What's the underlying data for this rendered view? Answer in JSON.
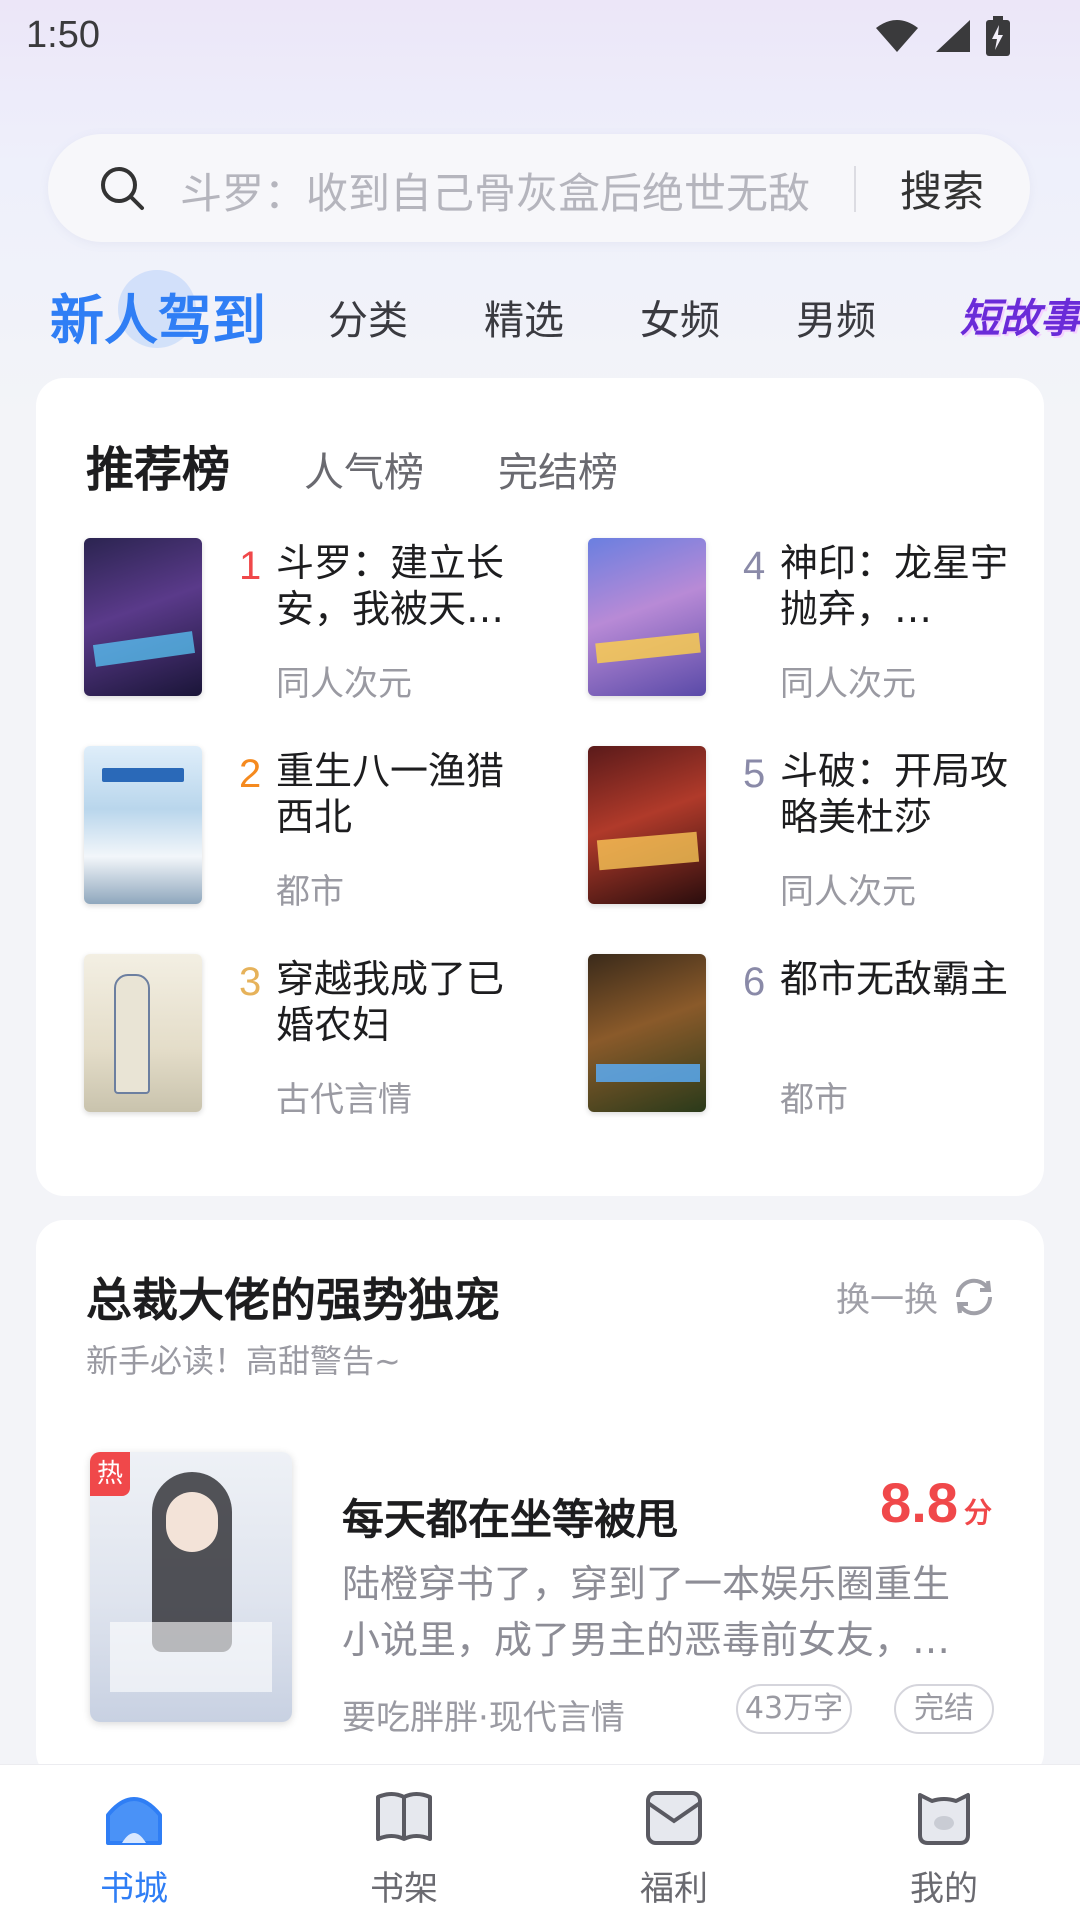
{
  "status": {
    "time": "1:50"
  },
  "search": {
    "placeholder": "斗罗：收到自己骨灰盒后绝世无敌",
    "button": "搜索"
  },
  "tabs": [
    {
      "label": "新人驾到",
      "active": true
    },
    {
      "label": "分类"
    },
    {
      "label": "精选"
    },
    {
      "label": "女频"
    },
    {
      "label": "男频"
    },
    {
      "label": "短故事"
    }
  ],
  "ranking": {
    "tabs": [
      "推荐榜",
      "人气榜",
      "完结榜"
    ],
    "items": [
      {
        "rank": "1",
        "title": "斗罗：建立长安，我被天…",
        "genre": "同人次元",
        "color": "#f0484a"
      },
      {
        "rank": "2",
        "title": "重生八一渔猎西北",
        "genre": "都市",
        "color": "#f58a1f"
      },
      {
        "rank": "3",
        "title": "穿越我成了已婚农妇",
        "genre": "古代言情",
        "color": "#e6b25a"
      },
      {
        "rank": "4",
        "title": "神印：龙星宇抛弃，…",
        "genre": "同人次元",
        "color": "#8a8aa8"
      },
      {
        "rank": "5",
        "title": "斗破：开局攻略美杜莎",
        "genre": "同人次元",
        "color": "#8a8aa8"
      },
      {
        "rank": "6",
        "title": "都市无敌霸主",
        "genre": "都市",
        "color": "#8a8aa8"
      }
    ]
  },
  "recommend": {
    "title": "总裁大佬的强势独宠",
    "subtitle": "新手必读！高甜警告~",
    "refresh": "换一换",
    "book": {
      "hot": "热",
      "name": "每天都在坐等被甩",
      "score": "8.8",
      "score_unit": "分",
      "desc": "陆橙穿书了，穿到了一本娱乐圈重生小说里，成了男主的恶毒前女友，…",
      "meta": "要吃胖胖·现代言情",
      "words": "43万字",
      "status": "完结"
    }
  },
  "bottom_nav": [
    {
      "label": "书城",
      "active": true
    },
    {
      "label": "书架"
    },
    {
      "label": "福利"
    },
    {
      "label": "我的"
    }
  ],
  "colors": {
    "accent": "#2f7ef5",
    "hot": "#f0484a"
  }
}
